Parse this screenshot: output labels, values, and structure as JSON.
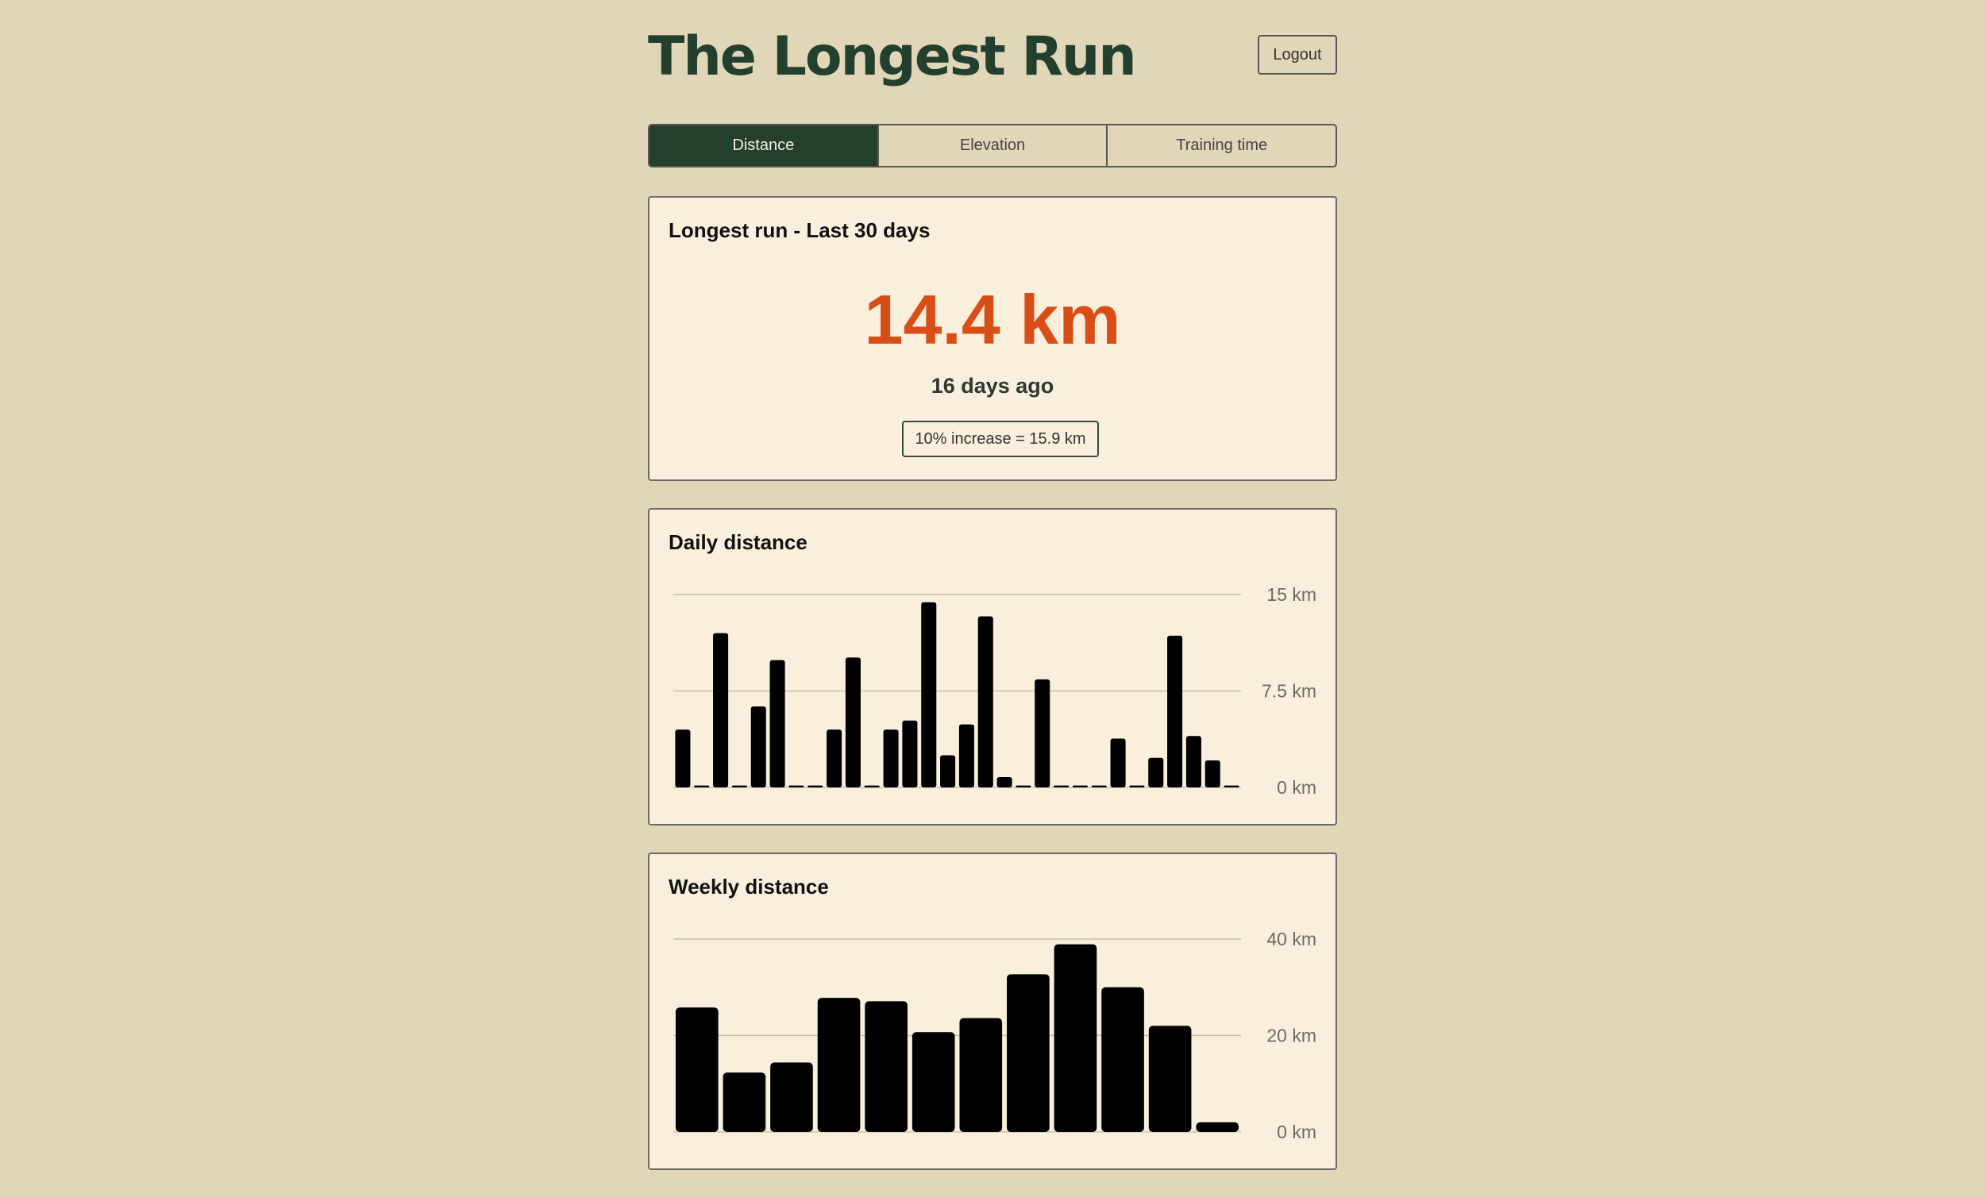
{
  "app": {
    "title": "The Longest Run",
    "logout_label": "Logout"
  },
  "tabs": [
    {
      "label": "Distance",
      "active": true
    },
    {
      "label": "Elevation",
      "active": false
    },
    {
      "label": "Training time",
      "active": false
    }
  ],
  "longest_run": {
    "title": "Longest run - Last 30 days",
    "value": "14.4 km",
    "ago": "16 days ago",
    "increase": "10% increase = 15.9 km"
  },
  "colors": {
    "background": "#e2d6b8",
    "card": "#faeedc",
    "accent_dark": "#23402f",
    "highlight": "#d94e16",
    "bar": "#000000"
  },
  "chart_data": [
    {
      "type": "bar",
      "title": "Daily distance",
      "unit": "km",
      "yticks": [
        0,
        7.5,
        15
      ],
      "tick_labels": [
        "0 km",
        "7.5 km",
        "15 km"
      ],
      "ylim": [
        0,
        15
      ],
      "grid": true,
      "values": [
        4.5,
        0.15,
        12.0,
        0.15,
        6.3,
        9.9,
        0.15,
        0.15,
        4.5,
        10.1,
        0.15,
        4.5,
        5.2,
        14.4,
        2.5,
        4.9,
        13.3,
        0.8,
        0.15,
        8.4,
        0.15,
        0.15,
        0.15,
        3.8,
        0.15,
        2.3,
        11.8,
        4.0,
        2.1,
        0.15
      ]
    },
    {
      "type": "bar",
      "title": "Weekly distance",
      "unit": "km",
      "yticks": [
        0,
        20,
        40
      ],
      "tick_labels": [
        "0 km",
        "20 km",
        "40 km"
      ],
      "ylim": [
        0,
        40
      ],
      "grid": true,
      "values": [
        25.8,
        12.3,
        14.4,
        27.8,
        27.1,
        20.7,
        23.6,
        32.7,
        38.9,
        30.0,
        22.0,
        2.0
      ]
    }
  ]
}
